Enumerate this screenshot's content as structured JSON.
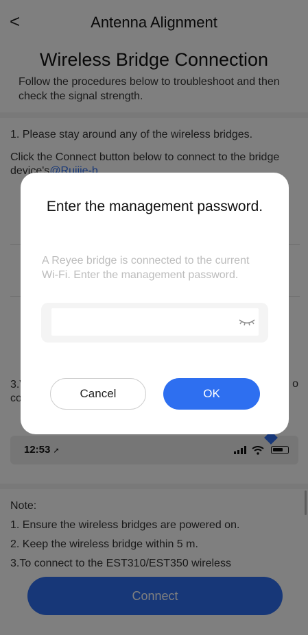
{
  "nav": {
    "title": "Antenna Alignment",
    "back_icon": "<"
  },
  "header": {
    "title": "Wireless Bridge Connection",
    "subtitle": "Follow the procedures below to troubleshoot and then check the signal strength."
  },
  "steps": {
    "step1": "1. Please stay around any of the wireless bridges.",
    "step1_detail": "Click the Connect button below to connect to the bridge device's",
    "step1_link": "@Ruijie-b",
    "step3_prefix": "3.V",
    "step3_prefix2": "co",
    "step3_suffix": "o"
  },
  "phone_preview": {
    "time": "12:53",
    "location_icon": "➚"
  },
  "notes": {
    "heading": "Note:",
    "items": [
      "1. Ensure the wireless bridges are powered on.",
      "2. Keep the wireless bridge within 5 m.",
      "3.To connect to the EST310/EST350 wireless"
    ]
  },
  "connect_button": "Connect",
  "dialog": {
    "title": "Enter the management password.",
    "description": "A Reyee bridge is connected to the current Wi-Fi. Enter the management password.",
    "password_value": "",
    "cancel_label": "Cancel",
    "ok_label": "OK"
  },
  "colors": {
    "accent": "#2e6ff0",
    "overlay": "rgba(0,0,0,0.5)"
  }
}
